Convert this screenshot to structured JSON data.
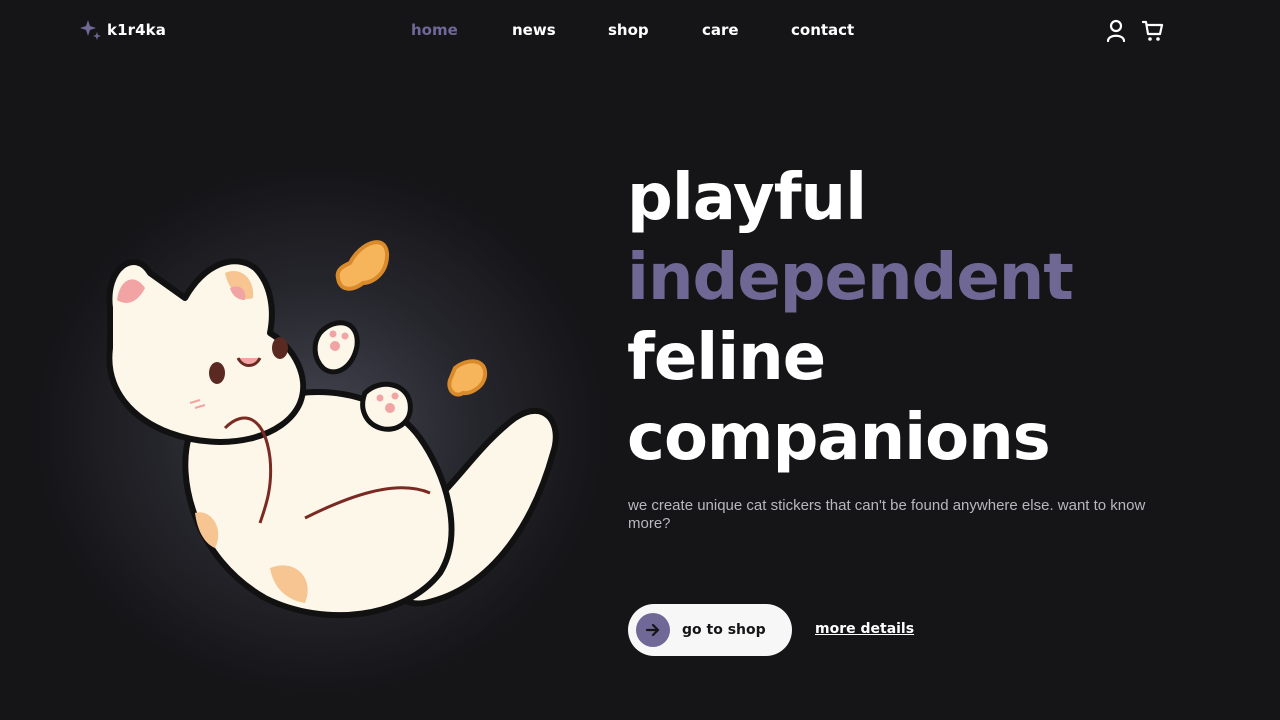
{
  "brand": {
    "name": "k1r4ka",
    "icon": "sparkle-icon",
    "icon_color": "#706896"
  },
  "nav": {
    "items": [
      {
        "label": "home",
        "active": true
      },
      {
        "label": "news"
      },
      {
        "label": "shop"
      },
      {
        "label": "care"
      },
      {
        "label": "contact"
      }
    ]
  },
  "header_icons": {
    "account": "user-icon",
    "cart": "cart-icon"
  },
  "hero": {
    "lines": [
      "playful",
      "independent",
      "feline",
      "companions"
    ],
    "description": "we create unique cat stickers that can't be found anywhere else. want to know more?",
    "primary_button": "go to shop",
    "secondary_link": "more details"
  },
  "colors": {
    "background": "#151518",
    "accent": "#706896",
    "text": "#ffffff",
    "muted_text": "#b7b7bd",
    "button_bg": "#f7f7f7"
  }
}
